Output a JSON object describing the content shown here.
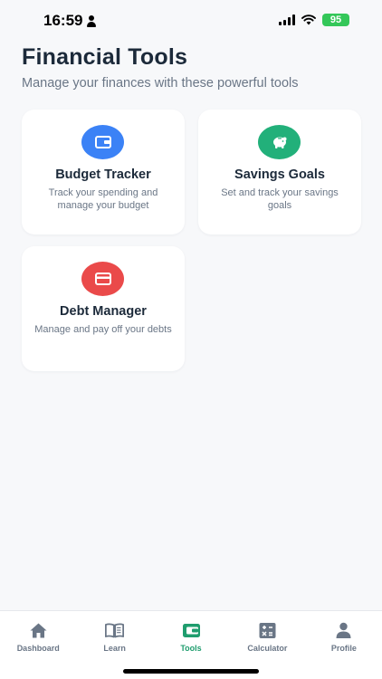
{
  "status_bar": {
    "time": "16:59",
    "battery": "95"
  },
  "header": {
    "title": "Financial Tools",
    "subtitle": "Manage your finances with these powerful tools"
  },
  "cards": [
    {
      "title": "Budget Tracker",
      "description": "Track your spending and manage your budget",
      "icon": "wallet-icon",
      "color": "#3b82f6"
    },
    {
      "title": "Savings Goals",
      "description": "Set and track your savings goals",
      "icon": "piggy-bank-icon",
      "color": "#22b07a"
    },
    {
      "title": "Debt Manager",
      "description": "Manage and pay off your debts",
      "icon": "credit-card-icon",
      "color": "#ea4a4a"
    }
  ],
  "tab_bar": {
    "active_color": "#1f9d6e",
    "inactive_color": "#6a7686",
    "tabs": [
      {
        "label": "Dashboard",
        "icon": "home-icon"
      },
      {
        "label": "Learn",
        "icon": "book-icon"
      },
      {
        "label": "Tools",
        "icon": "wallet-icon",
        "active": true
      },
      {
        "label": "Calculator",
        "icon": "calculator-icon"
      },
      {
        "label": "Profile",
        "icon": "person-icon"
      }
    ]
  }
}
